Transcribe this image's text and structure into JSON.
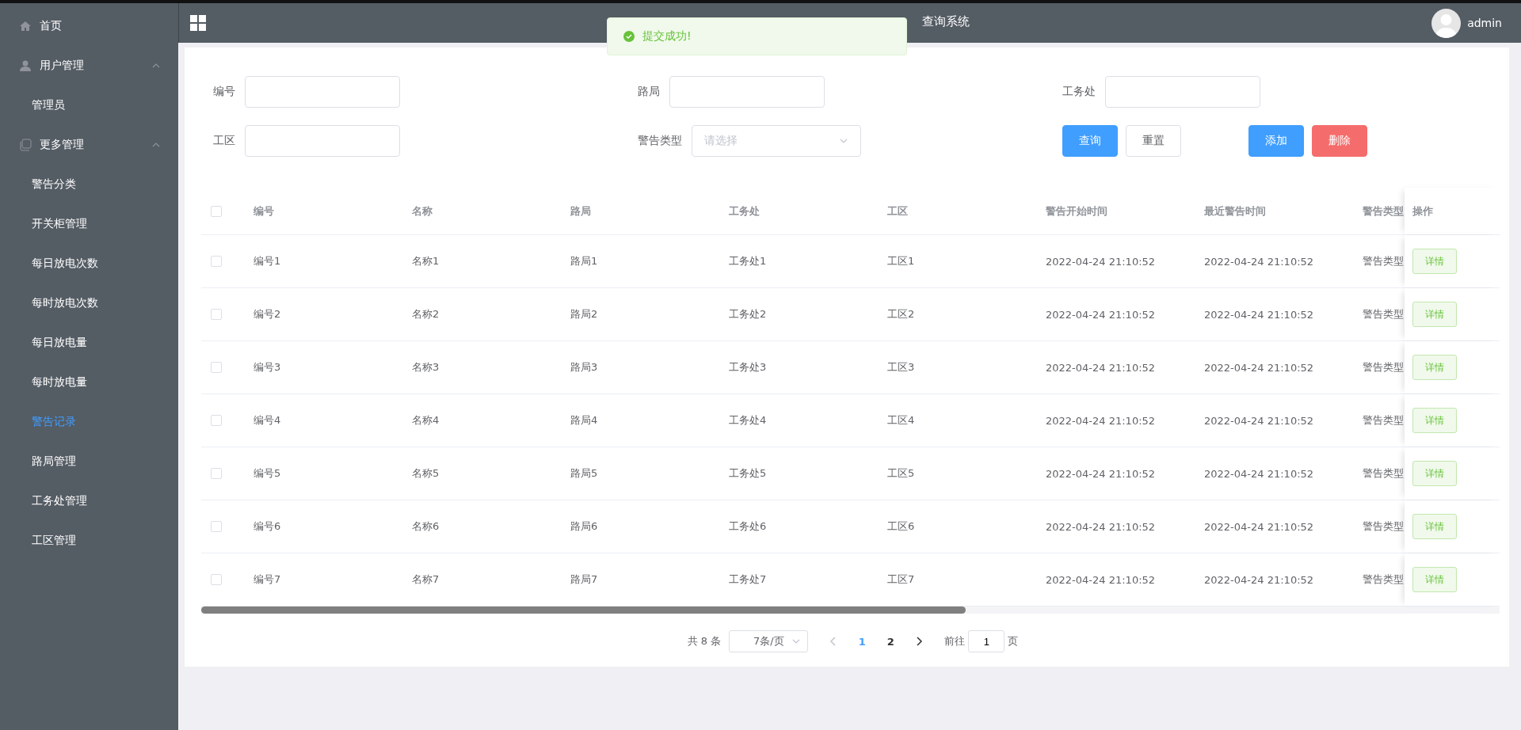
{
  "sidebar": {
    "items": [
      {
        "label": "首页",
        "kind": "link",
        "selected": false
      },
      {
        "label": "用户管理",
        "kind": "group",
        "expanded": true,
        "children": [
          {
            "label": "管理员",
            "selected": false
          }
        ]
      },
      {
        "label": "更多管理",
        "kind": "group",
        "expanded": true,
        "children": [
          {
            "label": "警告分类",
            "selected": false
          },
          {
            "label": "开关柜管理",
            "selected": false
          },
          {
            "label": "每日放电次数",
            "selected": false
          },
          {
            "label": "每时放电次数",
            "selected": false
          },
          {
            "label": "每日放电量",
            "selected": false
          },
          {
            "label": "每时放电量",
            "selected": false
          },
          {
            "label": "警告记录",
            "selected": true
          },
          {
            "label": "路局管理",
            "selected": false
          },
          {
            "label": "工务处管理",
            "selected": false
          },
          {
            "label": "工区管理",
            "selected": false
          }
        ]
      }
    ]
  },
  "header": {
    "title": "查询系统",
    "user": "admin"
  },
  "toast": {
    "kind": "success",
    "message": "提交成功!"
  },
  "filters": [
    {
      "label": "编号",
      "kind": "input"
    },
    {
      "label": "路局",
      "kind": "input"
    },
    {
      "label": "工务处",
      "kind": "input"
    },
    {
      "label": "工区",
      "kind": "input"
    },
    {
      "label": "警告类型",
      "kind": "select",
      "placeholder": "请选择"
    }
  ],
  "buttons": [
    {
      "label": "查询",
      "kind": "primary"
    },
    {
      "label": "重置",
      "kind": "default"
    },
    {
      "label": "添加",
      "kind": "primary"
    },
    {
      "label": "删除",
      "kind": "danger"
    }
  ],
  "table": {
    "all_checked": false,
    "columns": [
      "编号",
      "名称",
      "路局",
      "工务处",
      "工区",
      "警告开始时间",
      "最近警告时间",
      "警告类型",
      "操作"
    ],
    "rows": [
      {
        "checked": false,
        "cells": [
          "编号1",
          "名称1",
          "路局1",
          "工务处1",
          "工区1",
          "2022-04-24 21:10:52",
          "2022-04-24 21:10:52",
          "警告类型"
        ],
        "action": "详情"
      },
      {
        "checked": false,
        "cells": [
          "编号2",
          "名称2",
          "路局2",
          "工务处2",
          "工区2",
          "2022-04-24 21:10:52",
          "2022-04-24 21:10:52",
          "警告类型"
        ],
        "action": "详情"
      },
      {
        "checked": false,
        "cells": [
          "编号3",
          "名称3",
          "路局3",
          "工务处3",
          "工区3",
          "2022-04-24 21:10:52",
          "2022-04-24 21:10:52",
          "警告类型"
        ],
        "action": "详情"
      },
      {
        "checked": false,
        "cells": [
          "编号4",
          "名称4",
          "路局4",
          "工务处4",
          "工区4",
          "2022-04-24 21:10:52",
          "2022-04-24 21:10:52",
          "警告类型"
        ],
        "action": "详情"
      },
      {
        "checked": false,
        "cells": [
          "编号5",
          "名称5",
          "路局5",
          "工务处5",
          "工区5",
          "2022-04-24 21:10:52",
          "2022-04-24 21:10:52",
          "警告类型"
        ],
        "action": "详情"
      },
      {
        "checked": false,
        "cells": [
          "编号6",
          "名称6",
          "路局6",
          "工务处6",
          "工区6",
          "2022-04-24 21:10:52",
          "2022-04-24 21:10:52",
          "警告类型"
        ],
        "action": "详情"
      },
      {
        "checked": false,
        "cells": [
          "编号7",
          "名称7",
          "路局7",
          "工务处7",
          "工区7",
          "2022-04-24 21:10:52",
          "2022-04-24 21:10:52",
          "警告类型"
        ],
        "action": "详情"
      }
    ]
  },
  "pagination": {
    "total": "共 8 条",
    "page_size": "7条/页",
    "prev_disabled": true,
    "next_disabled": false,
    "pages": [
      {
        "label": "1",
        "selected": true
      },
      {
        "label": "2",
        "selected": false
      }
    ],
    "goto_label": "前往",
    "goto_value": "1",
    "goto_suffix": "页"
  }
}
